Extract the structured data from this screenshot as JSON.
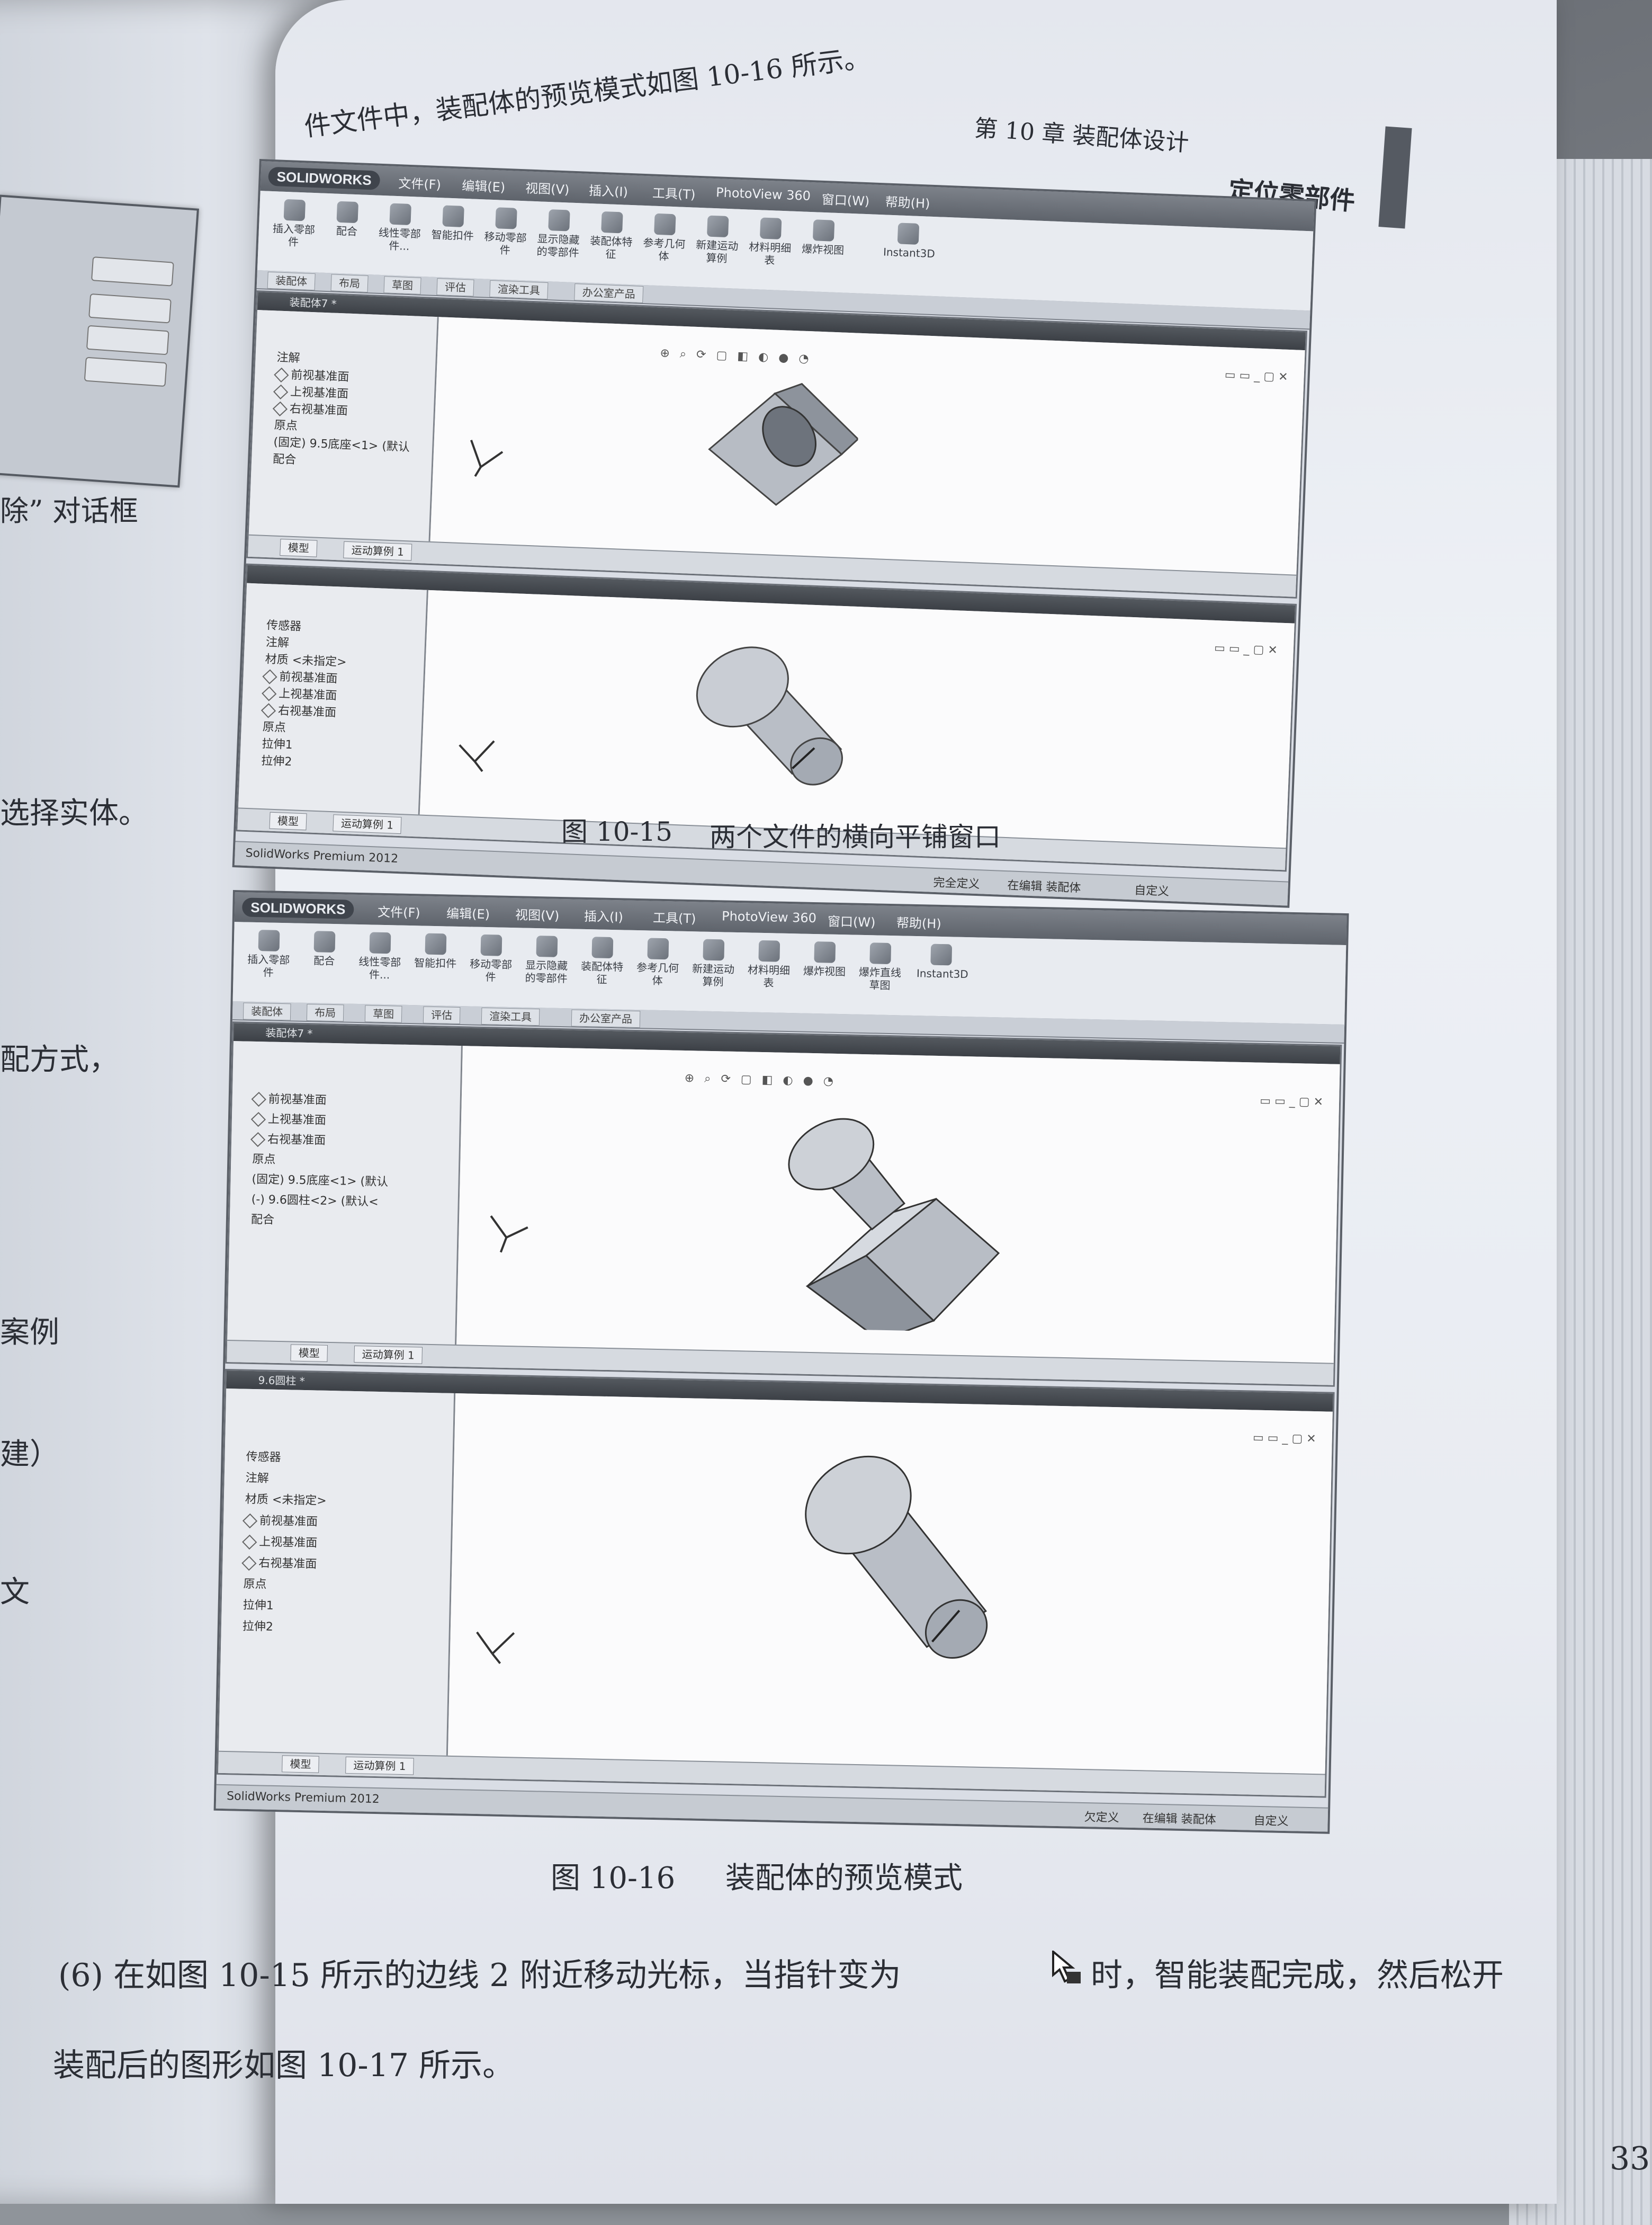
{
  "header": {
    "top_text": "件文件中，装配体的预览模式如图 10-16 所示。",
    "chapter": "第 10 章  装配体设计",
    "section": "定位零部件"
  },
  "left_page": {
    "fragments": [
      "除” 对话框",
      "选择实体。",
      "配方式，",
      "案例",
      "建）",
      "文"
    ]
  },
  "sw": {
    "logo": "SOLIDWORKS",
    "menus": [
      "文件(F)",
      "编辑(E)",
      "视图(V)",
      "插入(I)",
      "工具(T)",
      "PhotoView 360",
      "窗口(W)",
      "帮助(H)"
    ],
    "ribbon": [
      "插入零部件",
      "配合",
      "线性零部件...",
      "智能扣件",
      "移动零部件",
      "显示隐藏的零部件",
      "装配体特征",
      "参考几何体",
      "新建运动算例",
      "材料明细表",
      "爆炸视图",
      "爆炸直线草图",
      "Instant3D"
    ],
    "tabs": [
      "装配体",
      "布局",
      "草图",
      "评估",
      "渲染工具",
      "办公室产品"
    ],
    "bottom_tabs": [
      "模型",
      "运动算例 1"
    ],
    "status_left": "SolidWorks Premium 2012",
    "status_right": [
      "欠定义",
      "在编辑 装配体",
      "自定义"
    ]
  },
  "fig15": {
    "top_title": "装配体7 *",
    "top_tree": [
      "注解",
      "前视基准面",
      "上视基准面",
      "右视基准面",
      "原点",
      "(固定) 9.5底座<1> (默认",
      "配合"
    ],
    "bottom_tree": [
      "传感器",
      "注解",
      "材质 <未指定>",
      "前视基准面",
      "上视基准面",
      "右视基准面",
      "原点",
      "拉伸1",
      "拉伸2"
    ],
    "status_right": [
      "完全定义",
      "在编辑 装配体",
      "自定义"
    ],
    "caption_num": "图 10-15",
    "caption_text": "两个文件的横向平铺窗口"
  },
  "fig16": {
    "top_title": "装配体7 *",
    "bottom_title": "9.6圆柱 *",
    "top_tree": [
      "前视基准面",
      "上视基准面",
      "右视基准面",
      "原点",
      "(固定) 9.5底座<1> (默认",
      "(-) 9.6圆柱<2> (默认<",
      "配合"
    ],
    "bottom_tree": [
      "传感器",
      "注解",
      "材质 <未指定>",
      "前视基准面",
      "上视基准面",
      "右视基准面",
      "原点",
      "拉伸1",
      "拉伸2"
    ],
    "caption_num": "图 10-16",
    "caption_text": "装配体的预览模式"
  },
  "body": {
    "line1": "(6) 在如图 10-15 所示的边线 2 附近移动光标，当指针变为",
    "line1b": "时，智能装配完成，然后松开",
    "line2": "装配后的图形如图 10-17 所示。",
    "page_number": "33"
  }
}
